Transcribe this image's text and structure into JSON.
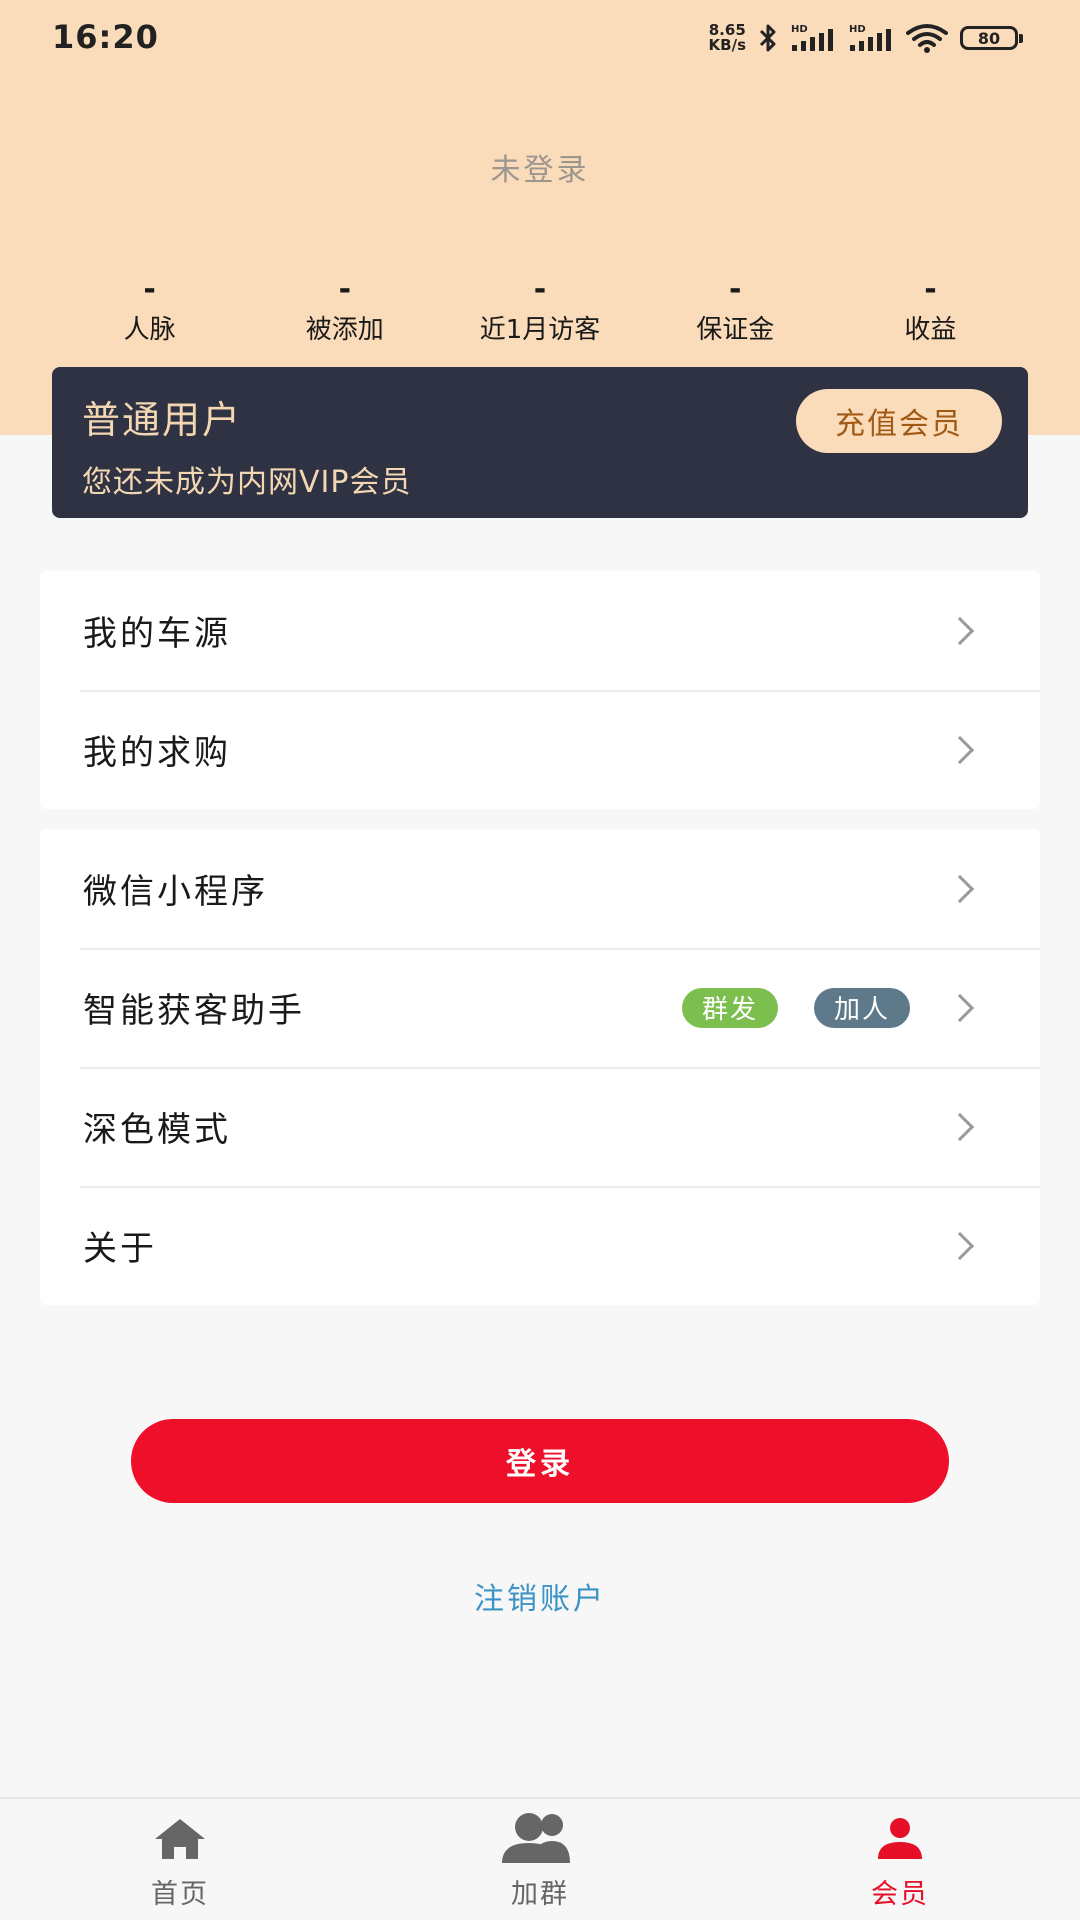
{
  "status_bar": {
    "time": "16:20",
    "net_speed_value": "8.65",
    "net_speed_unit": "KB/s",
    "battery": "80",
    "icons": [
      "bluetooth-icon",
      "signal-hd-icon",
      "signal-hd-icon",
      "wifi-icon",
      "battery-icon"
    ]
  },
  "profile": {
    "login_status": "未登录"
  },
  "stats": [
    {
      "value": "-",
      "label": "人脉"
    },
    {
      "value": "-",
      "label": "被添加"
    },
    {
      "value": "-",
      "label": "近1月访客"
    },
    {
      "value": "-",
      "label": "保证金"
    },
    {
      "value": "-",
      "label": "收益"
    }
  ],
  "vip_card": {
    "title": "普通用户",
    "subtitle": "您还未成为内网VIP会员",
    "button": "充值会员"
  },
  "menu_group_1": [
    {
      "label": "我的车源"
    },
    {
      "label": "我的求购"
    }
  ],
  "menu_group_2": [
    {
      "label": "微信小程序"
    },
    {
      "label": "智能获客助手",
      "tags": [
        "群发",
        "加人"
      ]
    },
    {
      "label": "深色模式"
    },
    {
      "label": "关于"
    }
  ],
  "actions": {
    "login": "登录",
    "cancel_account": "注销账户"
  },
  "bottom_nav": [
    {
      "label": "首页",
      "icon": "home-icon",
      "active": false
    },
    {
      "label": "加群",
      "icon": "group-icon",
      "active": false
    },
    {
      "label": "会员",
      "icon": "member-icon",
      "active": true
    }
  ],
  "colors": {
    "header_bg": "#fbdcba",
    "vip_card_bg": "#2f3242",
    "vip_text": "#f3d7b2",
    "primary_red": "#ee0f2a",
    "link_blue": "#3b93c6",
    "tag_green": "#7cbf4f",
    "tag_slate": "#5e7a8a"
  }
}
